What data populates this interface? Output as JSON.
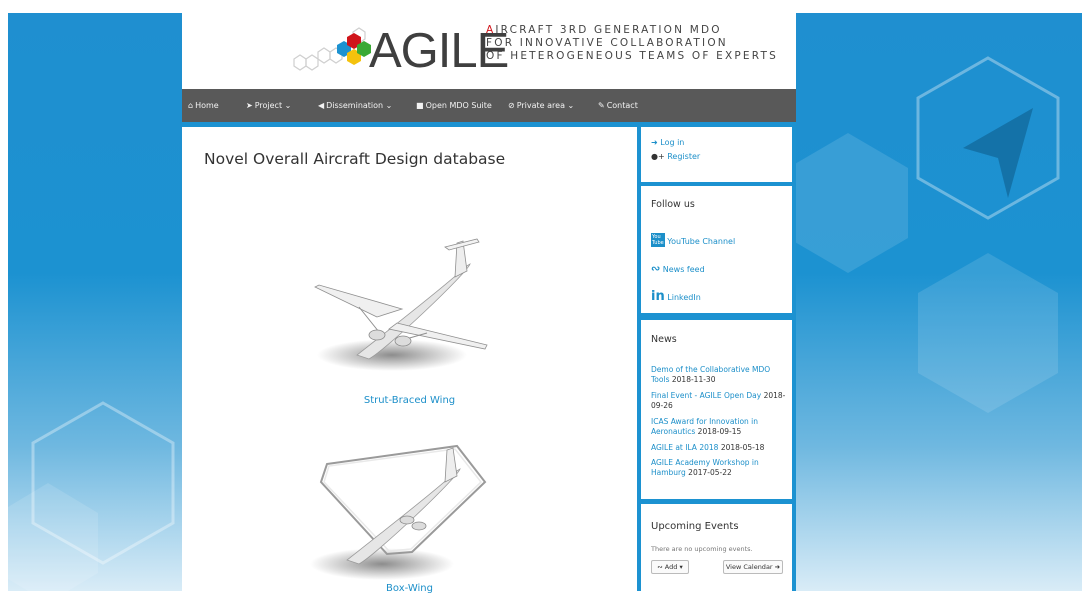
{
  "header": {
    "logo_word": "AGILE",
    "tagline_line1": "IRCRAFT 3RD GENERATION MDO",
    "tagline_line2": "FOR INNOVATIVE COLLABORATION",
    "tagline_line3": "OF HETEROGENEOUS TEAMS OF EXPERTS"
  },
  "nav": {
    "home": "Home",
    "project": "Project",
    "dissemination": "Dissemination",
    "open_mdo": "Open MDO Suite",
    "private": "Private area",
    "contact": "Contact"
  },
  "main": {
    "title": "Novel Overall Aircraft Design database",
    "items": [
      {
        "caption": "Strut-Braced Wing"
      },
      {
        "caption": "Box-Wing"
      }
    ]
  },
  "sidebar": {
    "login": "Log in",
    "register": "Register",
    "follow_heading": "Follow us",
    "youtube": "YouTube Channel",
    "news_feed": "News feed",
    "linkedin": "LinkedIn",
    "news_heading": "News",
    "news": [
      {
        "title": "Demo of the Collaborative MDO Tools",
        "date": "2018-11-30"
      },
      {
        "title": "Final Event - AGILE Open Day",
        "date": "2018-09-26"
      },
      {
        "title": "ICAS Award for Innovation in Aeronautics",
        "date": "2018-09-15"
      },
      {
        "title": "AGILE at ILA 2018",
        "date": "2018-05-18"
      },
      {
        "title": "AGILE Academy Workshop in Hamburg",
        "date": "2017-05-22"
      }
    ],
    "events_heading": "Upcoming Events",
    "no_events": "There are no upcoming events.",
    "add_button": "Add",
    "calendar_button": "View Calendar"
  },
  "colors": {
    "brand_blue": "#1c92d1",
    "nav_gray": "#595959",
    "logo_red": "#d0141a"
  }
}
